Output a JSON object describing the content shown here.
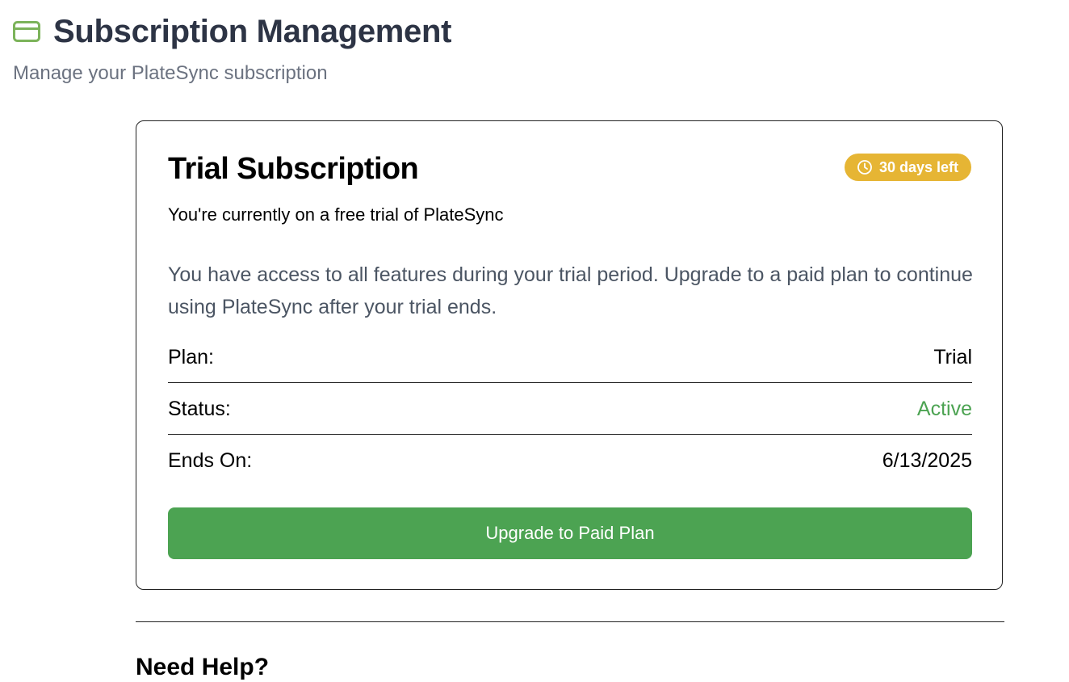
{
  "header": {
    "icon": "credit-card-icon",
    "title": "Subscription Management",
    "subtitle": "Manage your PlateSync subscription"
  },
  "subscription_card": {
    "title": "Trial Subscription",
    "badge": {
      "icon": "clock-icon",
      "label": "30 days left"
    },
    "description": "You're currently on a free trial of PlateSync",
    "info": "You have access to all features during your trial period. Upgrade to a paid plan to continue using PlateSync after your trial ends.",
    "details": [
      {
        "label": "Plan:",
        "value": "Trial"
      },
      {
        "label": "Status:",
        "value": "Active"
      },
      {
        "label": "Ends On:",
        "value": "6/13/2025"
      }
    ],
    "upgrade_button": "Upgrade to Paid Plan"
  },
  "help": {
    "heading": "Need Help?"
  },
  "colors": {
    "accent_green": "#4ca352",
    "badge_yellow": "#e6b534",
    "title_dark": "#2d3445"
  }
}
